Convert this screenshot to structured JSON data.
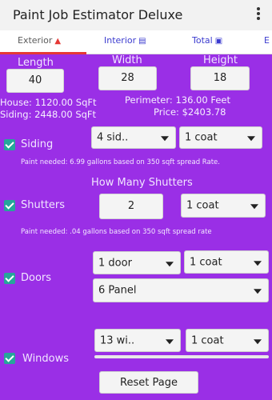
{
  "app": {
    "title": "Paint Job Estimator Deluxe"
  },
  "tabs": [
    {
      "label": "Exterior"
    },
    {
      "label": "Interior"
    },
    {
      "label": "Total"
    },
    {
      "label": "E"
    }
  ],
  "dimensions": {
    "length_label": "Length",
    "width_label": "Width",
    "height_label": "Height",
    "length_value": "40",
    "width_value": "28",
    "height_value": "18"
  },
  "summary": {
    "house": "House: 1120.00 SqFt",
    "siding": "Siding: 2448.00 SqFt",
    "perimeter": "Perimeter: 136.00 Feet",
    "price": "Price: $2403.78"
  },
  "siding": {
    "label": "Siding",
    "sides_value": "4 sid..",
    "coat_value": "1 coat",
    "note": "Paint needed: 6.99 gallons based on 350 sqft spread Rate."
  },
  "shutters": {
    "heading": "How Many Shutters",
    "label": "Shutters",
    "count": "2",
    "coat_value": "1 coat",
    "note": "Paint needed: .04 gallons based on 350 sqft spread rate"
  },
  "doors": {
    "label": "Doors",
    "count_value": "1 door",
    "coat_value": "1 coat",
    "type_value": "6 Panel"
  },
  "windows": {
    "label": "Windows",
    "count_value": "13 wi..",
    "coat_value": "1 coat"
  },
  "reset_label": "Reset Page"
}
